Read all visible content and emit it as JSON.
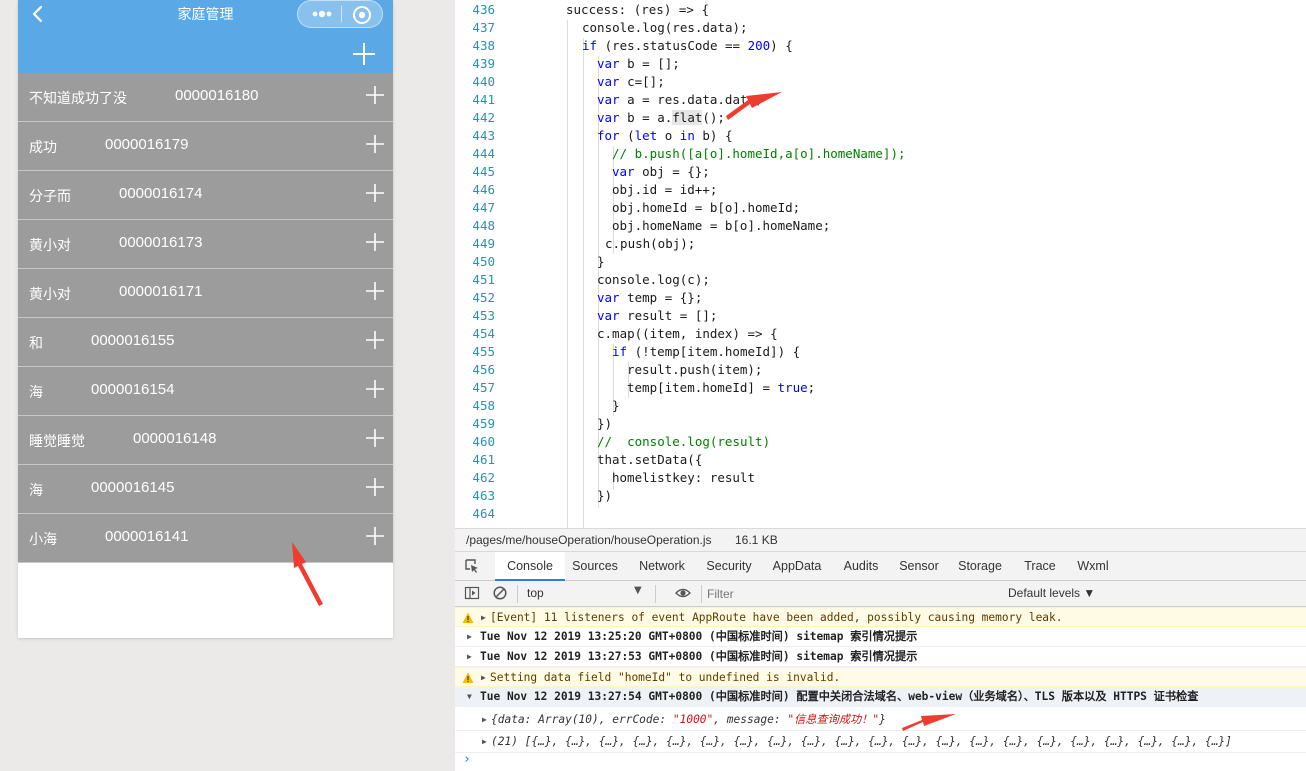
{
  "phone": {
    "title": "家庭管理",
    "houses": [
      {
        "name": "不知道成功了没",
        "id": "0000016180"
      },
      {
        "name": "成功",
        "id": "0000016179"
      },
      {
        "name": "分子而",
        "id": "0000016174"
      },
      {
        "name": "黄小对",
        "id": "0000016173"
      },
      {
        "name": "黄小对",
        "id": "0000016171"
      },
      {
        "name": "和",
        "id": "0000016155"
      },
      {
        "name": "海",
        "id": "0000016154"
      },
      {
        "name": "睡觉睡觉",
        "id": "0000016148"
      },
      {
        "name": "海",
        "id": "0000016145"
      },
      {
        "name": "小海",
        "id": "0000016141"
      }
    ],
    "colors": {
      "navbar": "#5aa9e6",
      "row": "#9c9c9c"
    }
  },
  "editor": {
    "line_numbers": [
      "436",
      "437",
      "438",
      "439",
      "440",
      "441",
      "442",
      "443",
      "444",
      "445",
      "446",
      "447",
      "448",
      "449",
      "450",
      "451",
      "452",
      "453",
      "454",
      "455",
      "456",
      "457",
      "458",
      "459",
      "460",
      "461",
      "462",
      "463",
      "464"
    ],
    "lines": [
      "success: (res) => {",
      "console.log(res.data);",
      "if (res.statusCode == 200) {",
      "var b = [];",
      "var c=[];",
      "var a = res.data.data;",
      "var b = a.flat();",
      "for (let o in b) {",
      "// b.push([a[o].homeId,a[o].homeName]);",
      "var obj = {};",
      "obj.id = id++;",
      "obj.homeId = b[o].homeId;",
      "obj.homeName = b[o].homeName;",
      "c.push(obj);",
      "}",
      "console.log(c);",
      "var temp = {};",
      "var result = [];",
      "c.map((item, index) => {",
      "if (!temp[item.homeId]) {",
      "result.push(item);",
      "temp[item.homeId] = true;",
      "}",
      "})",
      "//  console.log(result)",
      "that.setData({",
      "homelistkey: result",
      "})",
      ""
    ]
  },
  "statusbar": {
    "path": "/pages/me/houseOperation/houseOperation.js",
    "size": "16.1 KB"
  },
  "devtools": {
    "tabs": [
      "Console",
      "Sources",
      "Network",
      "Security",
      "AppData",
      "Audits",
      "Sensor",
      "Storage",
      "Trace",
      "Wxml"
    ],
    "context": "top",
    "filter_placeholder": "Filter",
    "levels": "Default levels ▼",
    "messages": [
      {
        "kind": "warn",
        "text": "[Event] 11 listeners of event AppRoute have been added, possibly causing memory leak."
      },
      {
        "kind": "log",
        "text": "Tue Nov 12 2019 13:25:20 GMT+0800 (中国标准时间) sitemap 索引情况提示"
      },
      {
        "kind": "log",
        "text": "Tue Nov 12 2019 13:27:53 GMT+0800 (中国标准时间) sitemap 索引情况提示"
      },
      {
        "kind": "warn",
        "text": "Setting data field \"homeId\" to undefined is invalid."
      },
      {
        "kind": "group",
        "text": "Tue Nov 12 2019 13:27:54 GMT+0800 (中国标准时间) 配置中关闭合法域名、web-view（业务域名）、TLS 版本以及 HTTPS 证书检查"
      },
      {
        "kind": "obj1",
        "pre": "{data: Array(10), errCode: ",
        "code": "\"1000\"",
        "mid": ", message: ",
        "msg": "\"信息查询成功！\"",
        "post": "}"
      },
      {
        "kind": "obj2",
        "text": "(21) [{…}, {…}, {…}, {…}, {…}, {…}, {…}, {…}, {…}, {…}, {…}, {…}, {…}, {…}, {…}, {…}, {…}, {…}, {…}, {…}, {…}]"
      }
    ],
    "prompt": "›"
  }
}
